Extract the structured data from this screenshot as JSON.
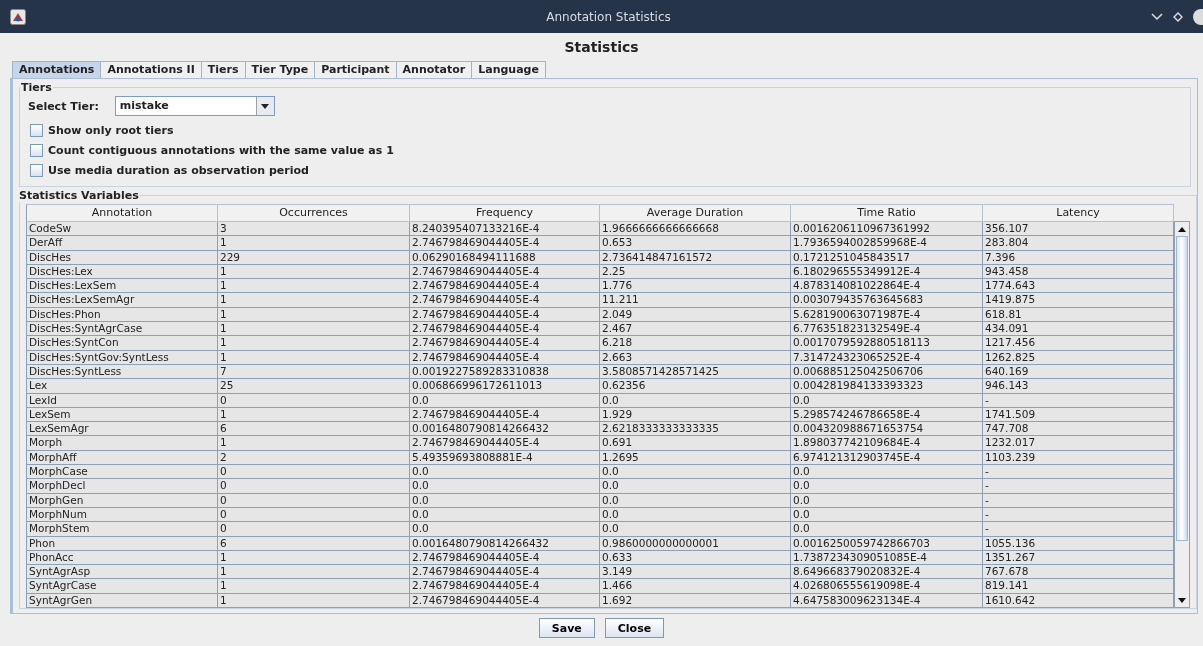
{
  "window": {
    "title": "Annotation Statistics"
  },
  "heading": "Statistics",
  "tabs": [
    {
      "label": "Annotations",
      "selected": true
    },
    {
      "label": "Annotations II",
      "selected": false
    },
    {
      "label": "Tiers",
      "selected": false
    },
    {
      "label": "Tier Type",
      "selected": false
    },
    {
      "label": "Participant",
      "selected": false
    },
    {
      "label": "Annotator",
      "selected": false
    },
    {
      "label": "Language",
      "selected": false
    }
  ],
  "tiers_group": {
    "title": "Tiers",
    "select_label": "Select Tier:",
    "select_value": "mistake",
    "options": [
      {
        "label": "Show only root tiers",
        "checked": false
      },
      {
        "label": "Count contiguous annotations with the same value as 1",
        "checked": false
      },
      {
        "label": "Use media duration as observation period",
        "checked": false
      }
    ]
  },
  "statistics_group": {
    "title": "Statistics Variables"
  },
  "table": {
    "columns": [
      "Annotation",
      "Occurrences",
      "Frequency",
      "Average Duration",
      "Time Ratio",
      "Latency"
    ],
    "rows": [
      [
        "CodeSw",
        "3",
        "8.240395407133216E-4",
        "1.9666666666666668",
        "0.0016206110967361992",
        "356.107"
      ],
      [
        "DerAff",
        "1",
        "2.746798469044405E-4",
        "0.653",
        "1.7936594002859968E-4",
        "283.804"
      ],
      [
        "DiscHes",
        "229",
        "0.06290168494111688",
        "2.736414847161572",
        "0.1721251045843517",
        "7.396"
      ],
      [
        "DiscHes:Lex",
        "1",
        "2.746798469044405E-4",
        "2.25",
        "6.180296555349912E-4",
        "943.458"
      ],
      [
        "DiscHes:LexSem",
        "1",
        "2.746798469044405E-4",
        "1.776",
        "4.878314081022864E-4",
        "1774.643"
      ],
      [
        "DiscHes:LexSemAgr",
        "1",
        "2.746798469044405E-4",
        "11.211",
        "0.003079435763645683",
        "1419.875"
      ],
      [
        "DiscHes:Phon",
        "1",
        "2.746798469044405E-4",
        "2.049",
        "5.628190063071987E-4",
        "618.81"
      ],
      [
        "DiscHes:SyntAgrCase",
        "1",
        "2.746798469044405E-4",
        "2.467",
        "6.776351823132549E-4",
        "434.091"
      ],
      [
        "DiscHes:SyntCon",
        "1",
        "2.746798469044405E-4",
        "6.218",
        "0.0017079592880518113",
        "1217.456"
      ],
      [
        "DiscHes:SyntGov:SyntLess",
        "1",
        "2.746798469044405E-4",
        "2.663",
        "7.314724323065252E-4",
        "1262.825"
      ],
      [
        "DiscHes:SyntLess",
        "7",
        "0.0019227589283310838",
        "3.5808571428571425",
        "0.006885125042506706",
        "640.169"
      ],
      [
        "Lex",
        "25",
        "0.006866996172611013",
        "0.62356",
        "0.004281984133393323",
        "946.143"
      ],
      [
        "LexId",
        "0",
        "0.0",
        "0.0",
        "0.0",
        "-"
      ],
      [
        "LexSem",
        "1",
        "2.746798469044405E-4",
        "1.929",
        "5.298574246786658E-4",
        "1741.509"
      ],
      [
        "LexSemAgr",
        "6",
        "0.0016480790814266432",
        "2.6218333333333335",
        "0.004320988671653754",
        "747.708"
      ],
      [
        "Morph",
        "1",
        "2.746798469044405E-4",
        "0.691",
        "1.898037742109684E-4",
        "1232.017"
      ],
      [
        "MorphAff",
        "2",
        "5.49359693808881E-4",
        "1.2695",
        "6.974121312903745E-4",
        "1103.239"
      ],
      [
        "MorphCase",
        "0",
        "0.0",
        "0.0",
        "0.0",
        "-"
      ],
      [
        "MorphDecl",
        "0",
        "0.0",
        "0.0",
        "0.0",
        "-"
      ],
      [
        "MorphGen",
        "0",
        "0.0",
        "0.0",
        "0.0",
        "-"
      ],
      [
        "MorphNum",
        "0",
        "0.0",
        "0.0",
        "0.0",
        "-"
      ],
      [
        "MorphStem",
        "0",
        "0.0",
        "0.0",
        "0.0",
        "-"
      ],
      [
        "Phon",
        "6",
        "0.0016480790814266432",
        "0.9860000000000001",
        "0.0016250059742866703",
        "1055.136"
      ],
      [
        "PhonAcc",
        "1",
        "2.746798469044405E-4",
        "0.633",
        "1.7387234309051085E-4",
        "1351.267"
      ],
      [
        "SyntAgrAsp",
        "1",
        "2.746798469044405E-4",
        "3.149",
        "8.649668379020832E-4",
        "767.678"
      ],
      [
        "SyntAgrCase",
        "1",
        "2.746798469044405E-4",
        "1.466",
        "4.026806555619098E-4",
        "819.141"
      ],
      [
        "SyntAgrGen",
        "1",
        "2.746798469044405E-4",
        "1.692",
        "4.647583009623134E-4",
        "1610.642"
      ]
    ]
  },
  "buttons": [
    "Save",
    "Close"
  ]
}
